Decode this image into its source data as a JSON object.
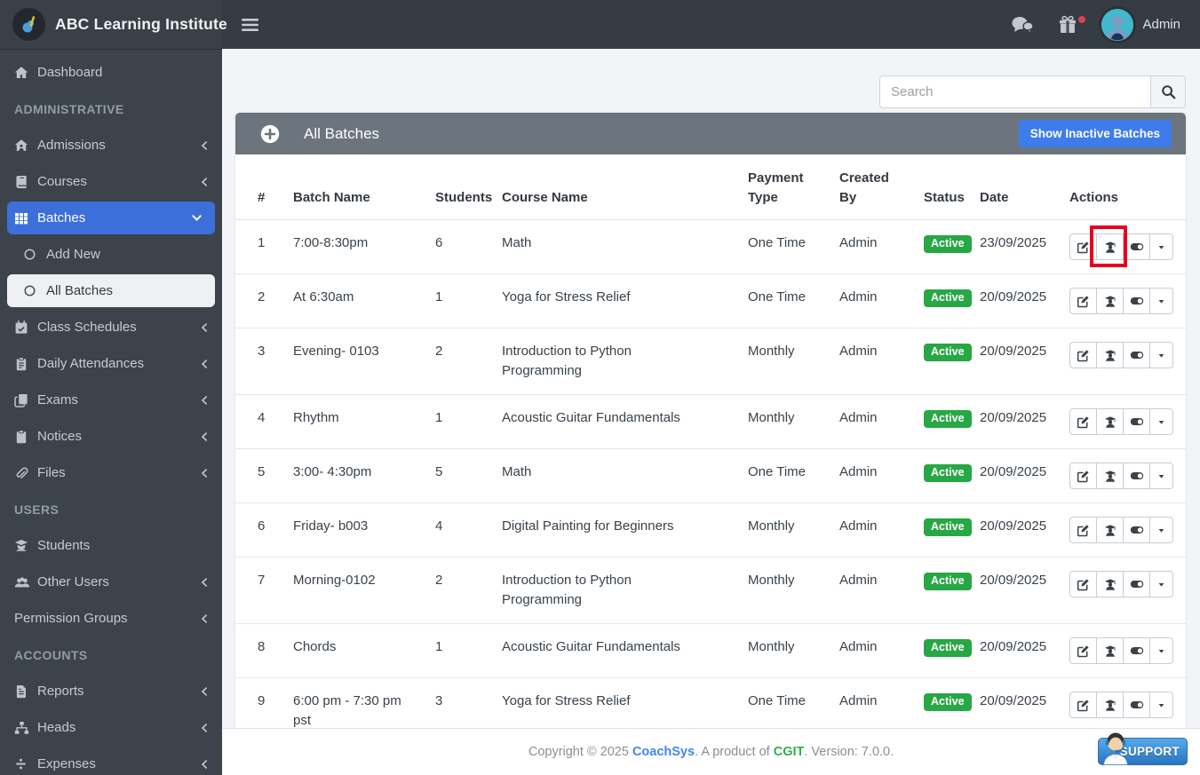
{
  "topbar": {
    "brand": "ABC Learning Institute",
    "user_name": "Admin"
  },
  "search": {
    "placeholder": "Search"
  },
  "panel": {
    "title": "All Batches",
    "show_inactive_button": "Show Inactive Batches"
  },
  "sidebar": {
    "items": [
      {
        "type": "item",
        "label": "Dashboard",
        "icon": "home"
      },
      {
        "type": "header",
        "label": "ADMINISTRATIVE"
      },
      {
        "type": "item",
        "label": "Admissions",
        "icon": "admission",
        "chevron": "left"
      },
      {
        "type": "item",
        "label": "Courses",
        "icon": "book",
        "chevron": "left"
      },
      {
        "type": "item",
        "label": "Batches",
        "icon": "grid",
        "chevron": "down",
        "active": true
      },
      {
        "type": "subitem",
        "label": "Add New",
        "icon": "circle"
      },
      {
        "type": "subitem",
        "label": "All Batches",
        "icon": "circle",
        "active": true
      },
      {
        "type": "item",
        "label": "Class Schedules",
        "icon": "calendar",
        "chevron": "left"
      },
      {
        "type": "item",
        "label": "Daily Attendances",
        "icon": "clipboard-list",
        "chevron": "left"
      },
      {
        "type": "item",
        "label": "Exams",
        "icon": "copy",
        "chevron": "left"
      },
      {
        "type": "item",
        "label": "Notices",
        "icon": "clipboard",
        "chevron": "left"
      },
      {
        "type": "item",
        "label": "Files",
        "icon": "paperclip",
        "chevron": "left"
      },
      {
        "type": "header",
        "label": "USERS"
      },
      {
        "type": "item",
        "label": "Students",
        "icon": "user-graduate"
      },
      {
        "type": "item",
        "label": "Other Users",
        "icon": "users",
        "chevron": "left"
      },
      {
        "type": "item",
        "label": "Permission Groups",
        "icon": "none",
        "chevron": "left"
      },
      {
        "type": "header",
        "label": "ACCOUNTS"
      },
      {
        "type": "item",
        "label": "Reports",
        "icon": "file",
        "chevron": "left"
      },
      {
        "type": "item",
        "label": "Heads",
        "icon": "sitemap",
        "chevron": "left"
      },
      {
        "type": "item",
        "label": "Expenses",
        "icon": "divide",
        "chevron": "left"
      }
    ]
  },
  "table": {
    "columns": [
      "#",
      "Batch Name",
      "Students",
      "Course Name",
      "Payment Type",
      "Created By",
      "Status",
      "Date",
      "Actions"
    ],
    "rows": [
      {
        "num": "1",
        "batch": "7:00-8:30pm",
        "students": "6",
        "course": "Math",
        "payment": "One Time",
        "created_by": "Admin",
        "status": "Active",
        "date": "23/09/2025"
      },
      {
        "num": "2",
        "batch": "At 6:30am",
        "students": "1",
        "course": "Yoga for Stress Relief",
        "payment": "One Time",
        "created_by": "Admin",
        "status": "Active",
        "date": "20/09/2025"
      },
      {
        "num": "3",
        "batch": "Evening- 0103",
        "students": "2",
        "course": "Introduction to Python Programming",
        "payment": "Monthly",
        "created_by": "Admin",
        "status": "Active",
        "date": "20/09/2025"
      },
      {
        "num": "4",
        "batch": "Rhythm",
        "students": "1",
        "course": "Acoustic Guitar Fundamentals",
        "payment": "Monthly",
        "created_by": "Admin",
        "status": "Active",
        "date": "20/09/2025"
      },
      {
        "num": "5",
        "batch": "3:00- 4:30pm",
        "students": "5",
        "course": "Math",
        "payment": "One Time",
        "created_by": "Admin",
        "status": "Active",
        "date": "20/09/2025"
      },
      {
        "num": "6",
        "batch": "Friday- b003",
        "students": "4",
        "course": "Digital Painting for Beginners",
        "payment": "Monthly",
        "created_by": "Admin",
        "status": "Active",
        "date": "20/09/2025"
      },
      {
        "num": "7",
        "batch": "Morning-0102",
        "students": "2",
        "course": "Introduction to Python Programming",
        "payment": "Monthly",
        "created_by": "Admin",
        "status": "Active",
        "date": "20/09/2025"
      },
      {
        "num": "8",
        "batch": "Chords",
        "students": "1",
        "course": "Acoustic Guitar Fundamentals",
        "payment": "Monthly",
        "created_by": "Admin",
        "status": "Active",
        "date": "20/09/2025"
      },
      {
        "num": "9",
        "batch": "6:00 pm - 7:30 pm pst",
        "students": "3",
        "course": "Yoga for Stress Relief",
        "payment": "One Time",
        "created_by": "Admin",
        "status": "Active",
        "date": "20/09/2025"
      }
    ]
  },
  "annotation": {
    "highlighted_row": 1,
    "highlighted_button": "students",
    "color": "#e8001f"
  },
  "footer": {
    "copyright_prefix": "Copyright © 2025 ",
    "brand": "CoachSys",
    "middle": ". A product of ",
    "company": "CGIT",
    "suffix": ". Version: 7.0.0.",
    "support_label": "SUPPORT"
  },
  "colors": {
    "topbar": "#363c43",
    "sidebar": "#3d434b",
    "accent_blue": "#3c6fd9",
    "button_blue": "#3d7cea",
    "panel_header": "#6c757d",
    "active_badge": "#28a745",
    "annotation_red": "#e8001f",
    "footer_brand_blue": "#4285f4",
    "footer_company_green": "#2eaf4e"
  }
}
